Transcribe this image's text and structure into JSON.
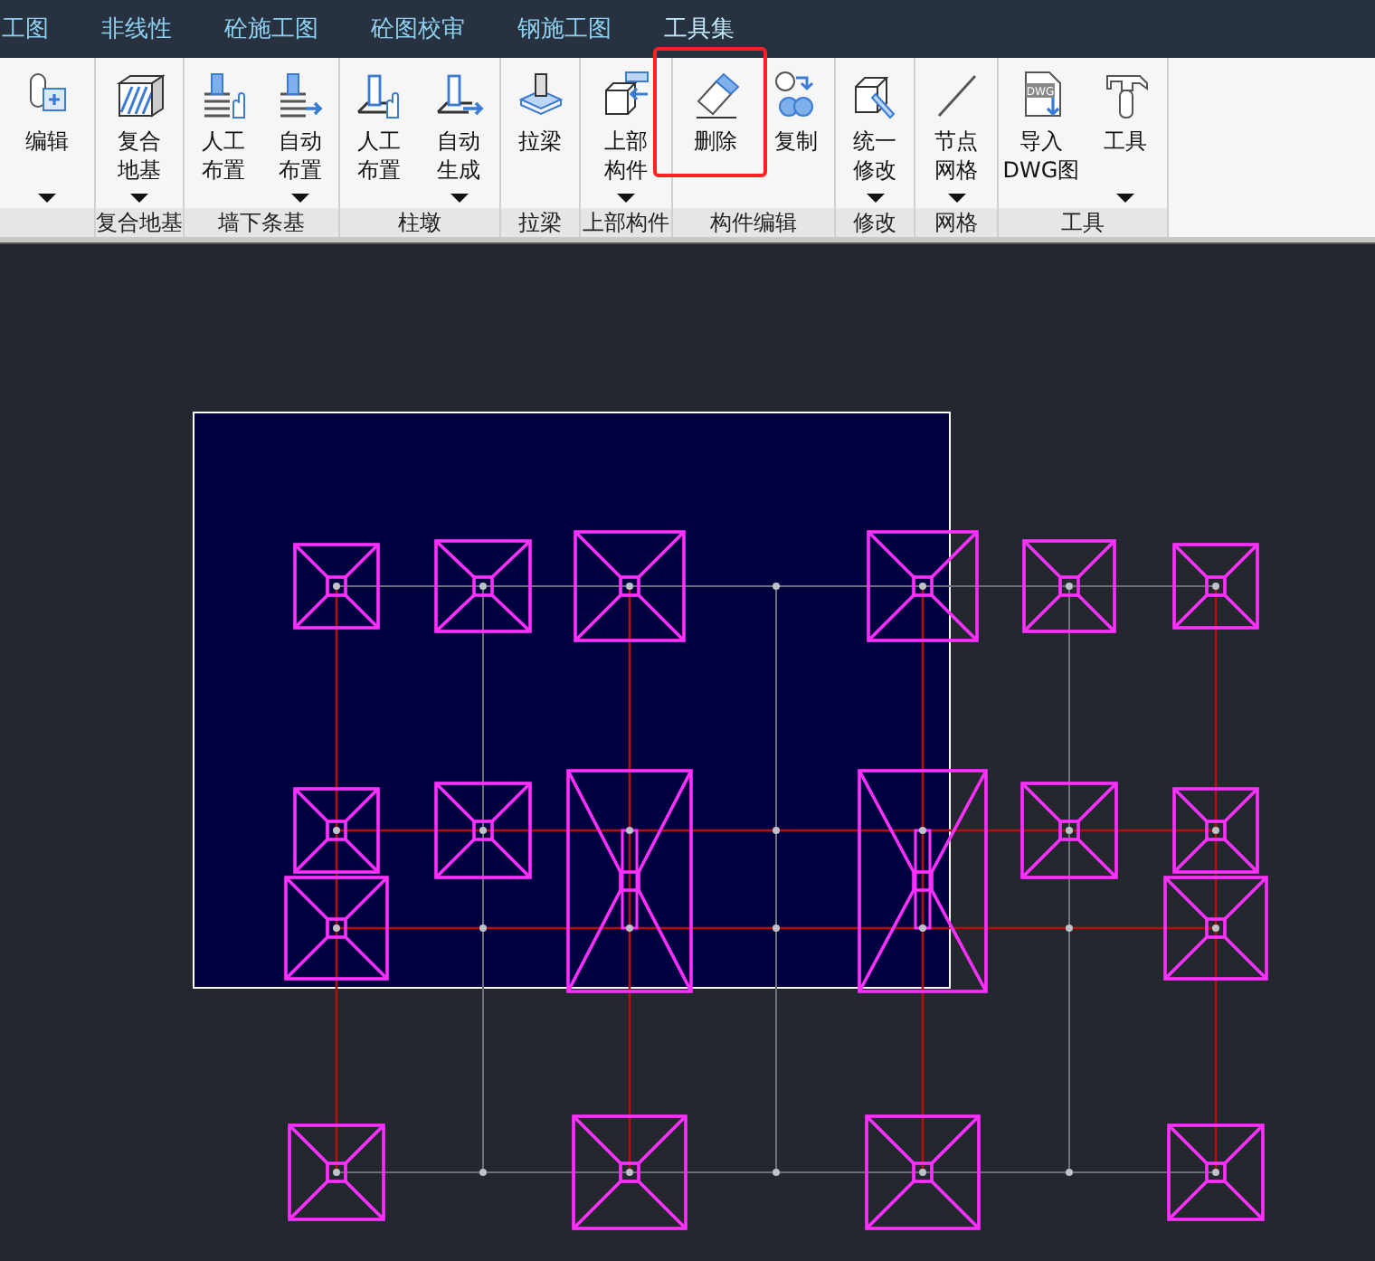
{
  "tabs": [
    {
      "label": "工图",
      "selected": false
    },
    {
      "label": "非线性",
      "selected": false
    },
    {
      "label": "砼施工图",
      "selected": false
    },
    {
      "label": "砼图校审",
      "selected": false
    },
    {
      "label": "钢施工图",
      "selected": false
    },
    {
      "label": "工具集",
      "selected": true
    }
  ],
  "ribbon_groups": [
    {
      "buttons": [
        {
          "lines": [
            "编辑"
          ],
          "dropdown": true,
          "highlighted": false
        }
      ]
    },
    {
      "label": "复合地基",
      "buttons": [
        {
          "lines": [
            "复合",
            "地基"
          ],
          "dropdown": true,
          "highlighted": false
        }
      ]
    },
    {
      "label": "墙下条基",
      "buttons": [
        {
          "lines": [
            "人工",
            "布置"
          ],
          "dropdown": false,
          "highlighted": false
        },
        {
          "lines": [
            "自动",
            "布置"
          ],
          "dropdown": true,
          "highlighted": false
        }
      ]
    },
    {
      "label": "柱墩",
      "buttons": [
        {
          "lines": [
            "人工",
            "布置"
          ],
          "dropdown": false,
          "highlighted": false
        },
        {
          "lines": [
            "自动",
            "生成"
          ],
          "dropdown": true,
          "highlighted": false
        }
      ]
    },
    {
      "label": "拉梁",
      "buttons": [
        {
          "lines": [
            "拉梁"
          ],
          "dropdown": false,
          "highlighted": false
        }
      ]
    },
    {
      "label": "上部构件",
      "buttons": [
        {
          "lines": [
            "上部",
            "构件"
          ],
          "dropdown": true,
          "highlighted": false
        }
      ]
    },
    {
      "label": "构件编辑",
      "buttons": [
        {
          "lines": [
            "删除"
          ],
          "dropdown": false,
          "highlighted": true
        },
        {
          "lines": [
            "复制"
          ],
          "dropdown": false,
          "highlighted": false
        }
      ]
    },
    {
      "label": "修改",
      "buttons": [
        {
          "lines": [
            "统一",
            "修改"
          ],
          "dropdown": true,
          "highlighted": false
        }
      ]
    },
    {
      "label": "网格",
      "buttons": [
        {
          "lines": [
            "节点",
            "网格"
          ],
          "dropdown": true,
          "highlighted": false
        }
      ]
    },
    {
      "label": "工具",
      "buttons": [
        {
          "lines": [
            "导入",
            "DWG图"
          ],
          "dropdown": false,
          "highlighted": false,
          "icon_text": "DWG"
        },
        {
          "lines": [
            "工具"
          ],
          "dropdown": true,
          "highlighted": false
        }
      ]
    }
  ]
}
